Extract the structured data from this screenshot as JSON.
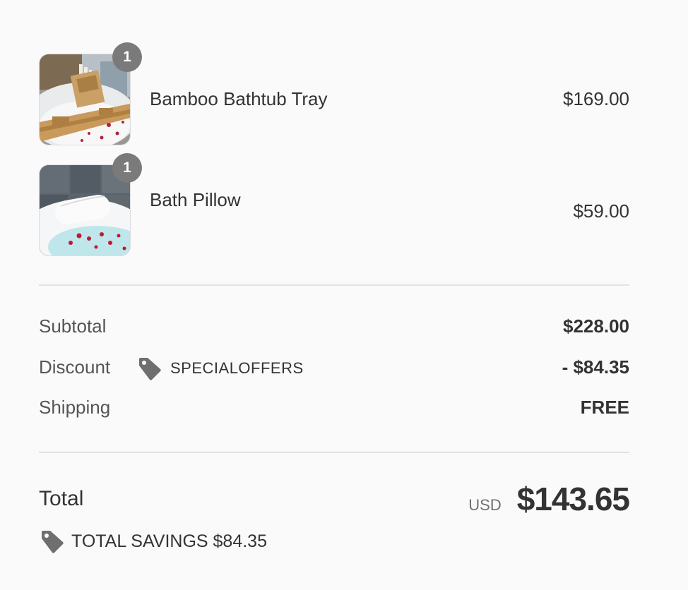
{
  "line_items": [
    {
      "name": "Bamboo Bathtub Tray",
      "price": "$169.00",
      "quantity": "1",
      "image_icon": "bathtub-tray-photo"
    },
    {
      "name": "Bath Pillow",
      "price": "$59.00",
      "quantity": "1",
      "image_icon": "bath-pillow-photo"
    }
  ],
  "costs": {
    "subtotal_label": "Subtotal",
    "subtotal_value": "$228.00",
    "discount_label": "Discount",
    "discount_code": "SPECIALOFFERS",
    "discount_value": "- $84.35",
    "shipping_label": "Shipping",
    "shipping_value": "FREE"
  },
  "total": {
    "label": "Total",
    "currency": "USD",
    "amount": "$143.65",
    "savings_text": "TOTAL SAVINGS $84.35"
  },
  "icons": {
    "discount": "tag-icon",
    "savings": "tag-icon"
  },
  "colors": {
    "background": "#fafafa",
    "badge": "#7a7a7a",
    "tag": "#6f6f6f",
    "text": "#333333",
    "muted": "#555555",
    "divider": "#e2e2e2"
  }
}
